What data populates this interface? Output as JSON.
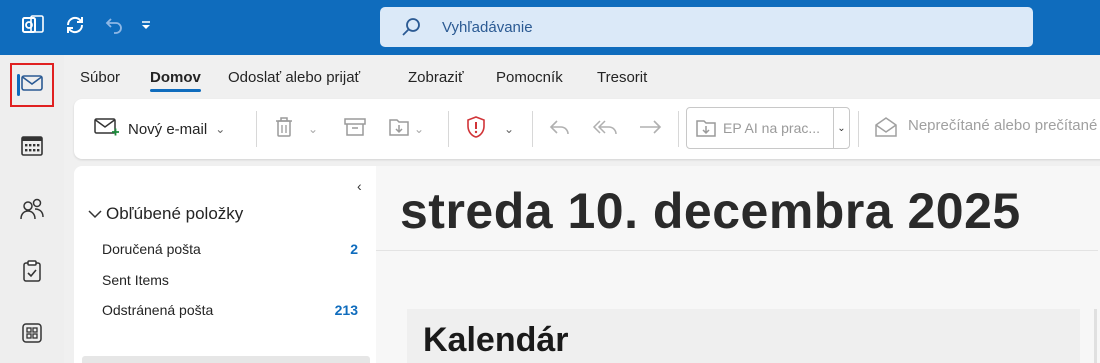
{
  "titlebar": {
    "search_placeholder": "Vyhľadávanie",
    "icons": [
      "outlook-logo-icon",
      "sync-icon",
      "undo-icon",
      "customize-dropdown-icon"
    ]
  },
  "rail": {
    "items": [
      {
        "name": "mail",
        "icon": "mail-icon",
        "active": true
      },
      {
        "name": "calendar",
        "icon": "calendar-icon",
        "active": false
      },
      {
        "name": "people",
        "icon": "people-icon",
        "active": false
      },
      {
        "name": "tasks",
        "icon": "clipboard-check-icon",
        "active": false
      },
      {
        "name": "apps",
        "icon": "apps-grid-icon",
        "active": false
      }
    ]
  },
  "tabs": [
    {
      "label": "Súbor",
      "active": false
    },
    {
      "label": "Domov",
      "active": true
    },
    {
      "label": "Odoslať alebo prijať",
      "active": false
    },
    {
      "label": "Zobraziť",
      "active": false
    },
    {
      "label": "Pomocník",
      "active": false
    },
    {
      "label": "Tresorit",
      "active": false
    }
  ],
  "ribbon": {
    "new_email": "Nový e-mail",
    "quick_step": "EP AI na prac...",
    "unread": "Neprečítané alebo prečítané"
  },
  "folders": {
    "favorites_header": "Obľúbené položky",
    "items": [
      {
        "label": "Doručená pošta",
        "count": "2"
      },
      {
        "label": "Sent Items",
        "count": ""
      },
      {
        "label": "Odstránená pošta",
        "count": "213"
      }
    ]
  },
  "main": {
    "date": "streda 10. decembra 2025",
    "card_title": "Kalendár"
  },
  "colors": {
    "accent": "#0f6cbd",
    "highlight_border": "#e02020"
  }
}
